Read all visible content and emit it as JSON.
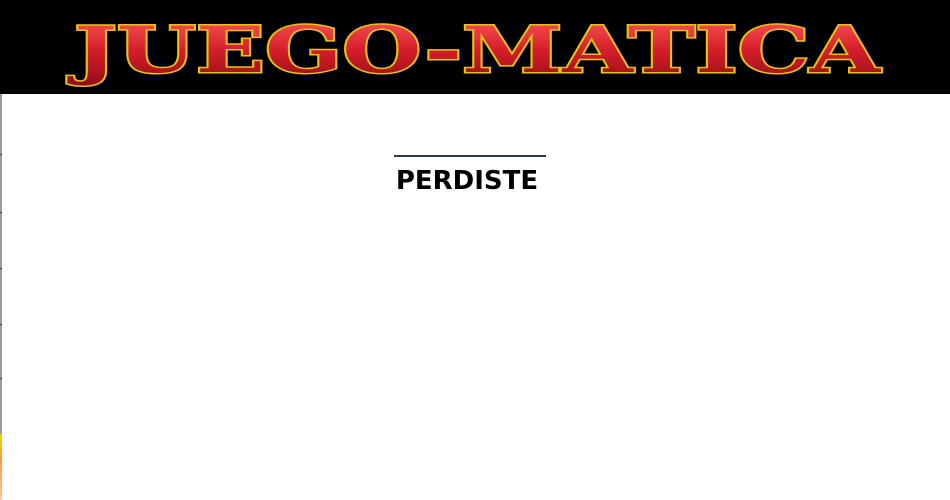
{
  "header": {
    "logo_text": "JUEGO-MATICA",
    "background": "#000000",
    "logo_fill": "#d4202c",
    "logo_outline": "#e8c21a"
  },
  "game": {
    "result_text": "PERDISTE"
  }
}
